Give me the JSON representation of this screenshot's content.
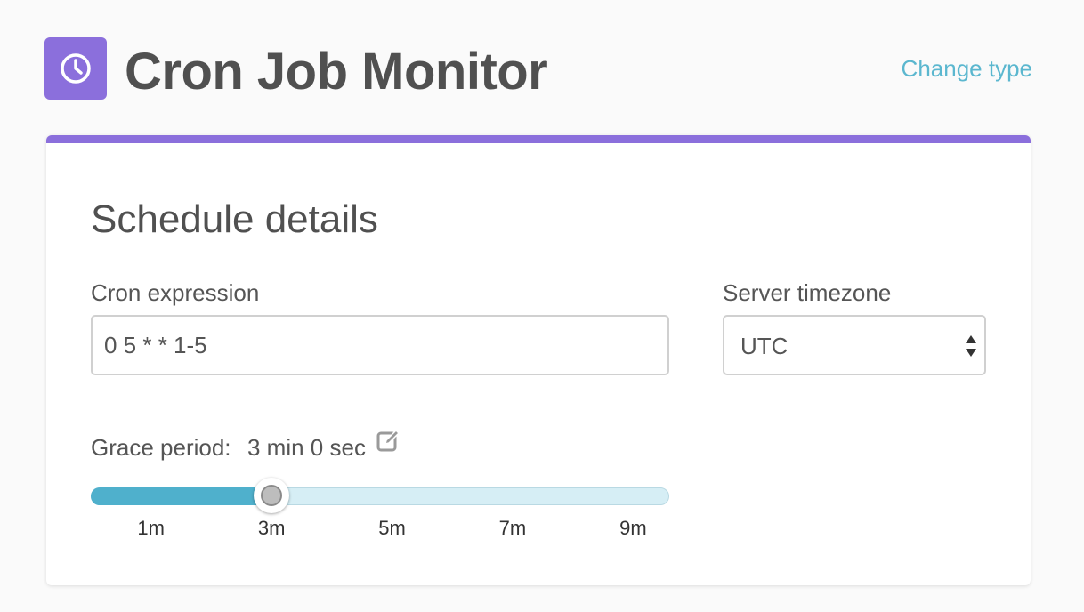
{
  "header": {
    "title": "Cron Job Monitor",
    "icon": "clock-icon",
    "change_type_label": "Change type",
    "accent_color": "#8b6fdc",
    "link_color": "#5bb7cf"
  },
  "schedule": {
    "section_title": "Schedule details",
    "cron_label": "Cron expression",
    "cron_value": "0 5 * * 1-5",
    "timezone_label": "Server timezone",
    "timezone_value": "UTC",
    "grace_label": "Grace period:",
    "grace_value": "3 min 0 sec",
    "edit_icon": "edit-icon",
    "slider": {
      "min_minutes": 0,
      "max_minutes": 9.6,
      "value_minutes": 3,
      "ticks": [
        "1m",
        "3m",
        "5m",
        "7m",
        "9m"
      ],
      "tick_values": [
        1,
        3,
        5,
        7,
        9
      ]
    }
  }
}
